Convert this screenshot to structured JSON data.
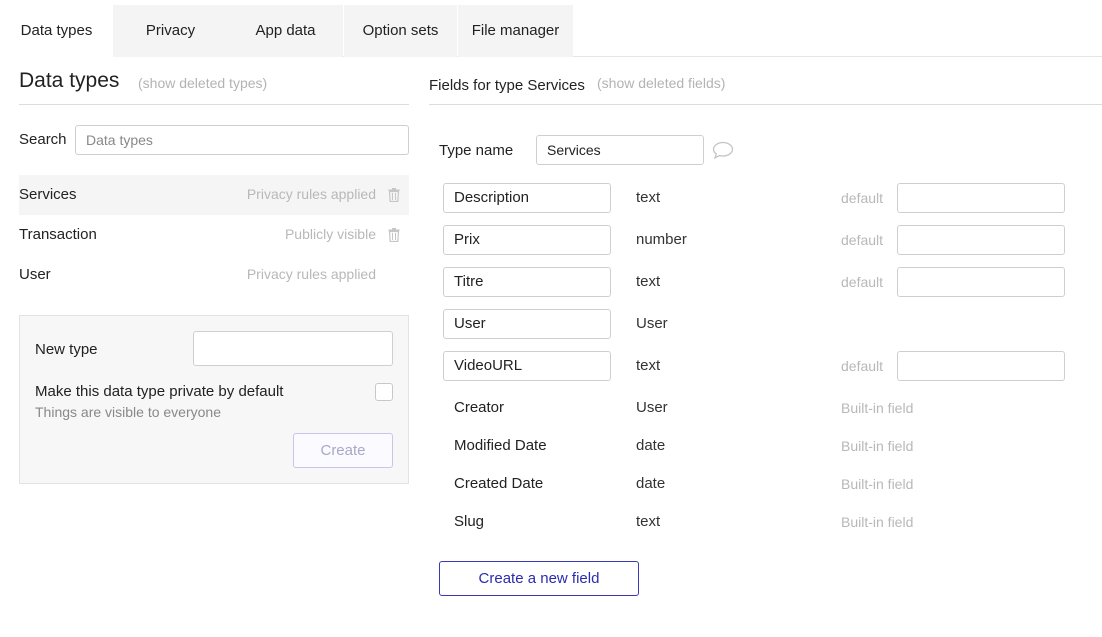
{
  "tabs": [
    {
      "label": "Data types",
      "active": true
    },
    {
      "label": "Privacy",
      "active": false
    },
    {
      "label": "App data",
      "active": false
    },
    {
      "label": "Option sets",
      "active": false
    },
    {
      "label": "File manager",
      "active": false
    }
  ],
  "left": {
    "title": "Data types",
    "show_deleted": "(show deleted types)",
    "search_label": "Search",
    "search_placeholder": "Data types",
    "types": [
      {
        "name": "Services",
        "status": "Privacy rules applied",
        "selected": true,
        "has_trash": true
      },
      {
        "name": "Transaction",
        "status": "Publicly visible",
        "selected": false,
        "has_trash": true
      },
      {
        "name": "User",
        "status": "Privacy rules applied",
        "selected": false,
        "has_trash": false
      }
    ],
    "new_type": {
      "label": "New type",
      "value": "",
      "private_label": "Make this data type private by default",
      "private_sub": "Things are visible to everyone",
      "private_checked": false,
      "create_label": "Create"
    }
  },
  "right": {
    "title": "Fields for type Services",
    "show_deleted": "(show deleted fields)",
    "type_name_label": "Type name",
    "type_name_value": "Services",
    "default_label": "default",
    "builtin_label": "Built-in field",
    "custom_fields": [
      {
        "name": "Description",
        "type": "text",
        "has_default": true
      },
      {
        "name": "Prix",
        "type": "number",
        "has_default": true
      },
      {
        "name": "Titre",
        "type": "text",
        "has_default": true
      },
      {
        "name": "User",
        "type": "User",
        "has_default": false
      },
      {
        "name": "VideoURL",
        "type": "text",
        "has_default": true
      }
    ],
    "builtin_fields": [
      {
        "name": "Creator",
        "type": "User"
      },
      {
        "name": "Modified Date",
        "type": "date"
      },
      {
        "name": "Created Date",
        "type": "date"
      },
      {
        "name": "Slug",
        "type": "text"
      }
    ],
    "create_field_label": "Create a new field"
  },
  "colors": {
    "accent": "#2b2bb0",
    "muted": "#b8b8b8",
    "selected_row": "#f5f5f5"
  }
}
